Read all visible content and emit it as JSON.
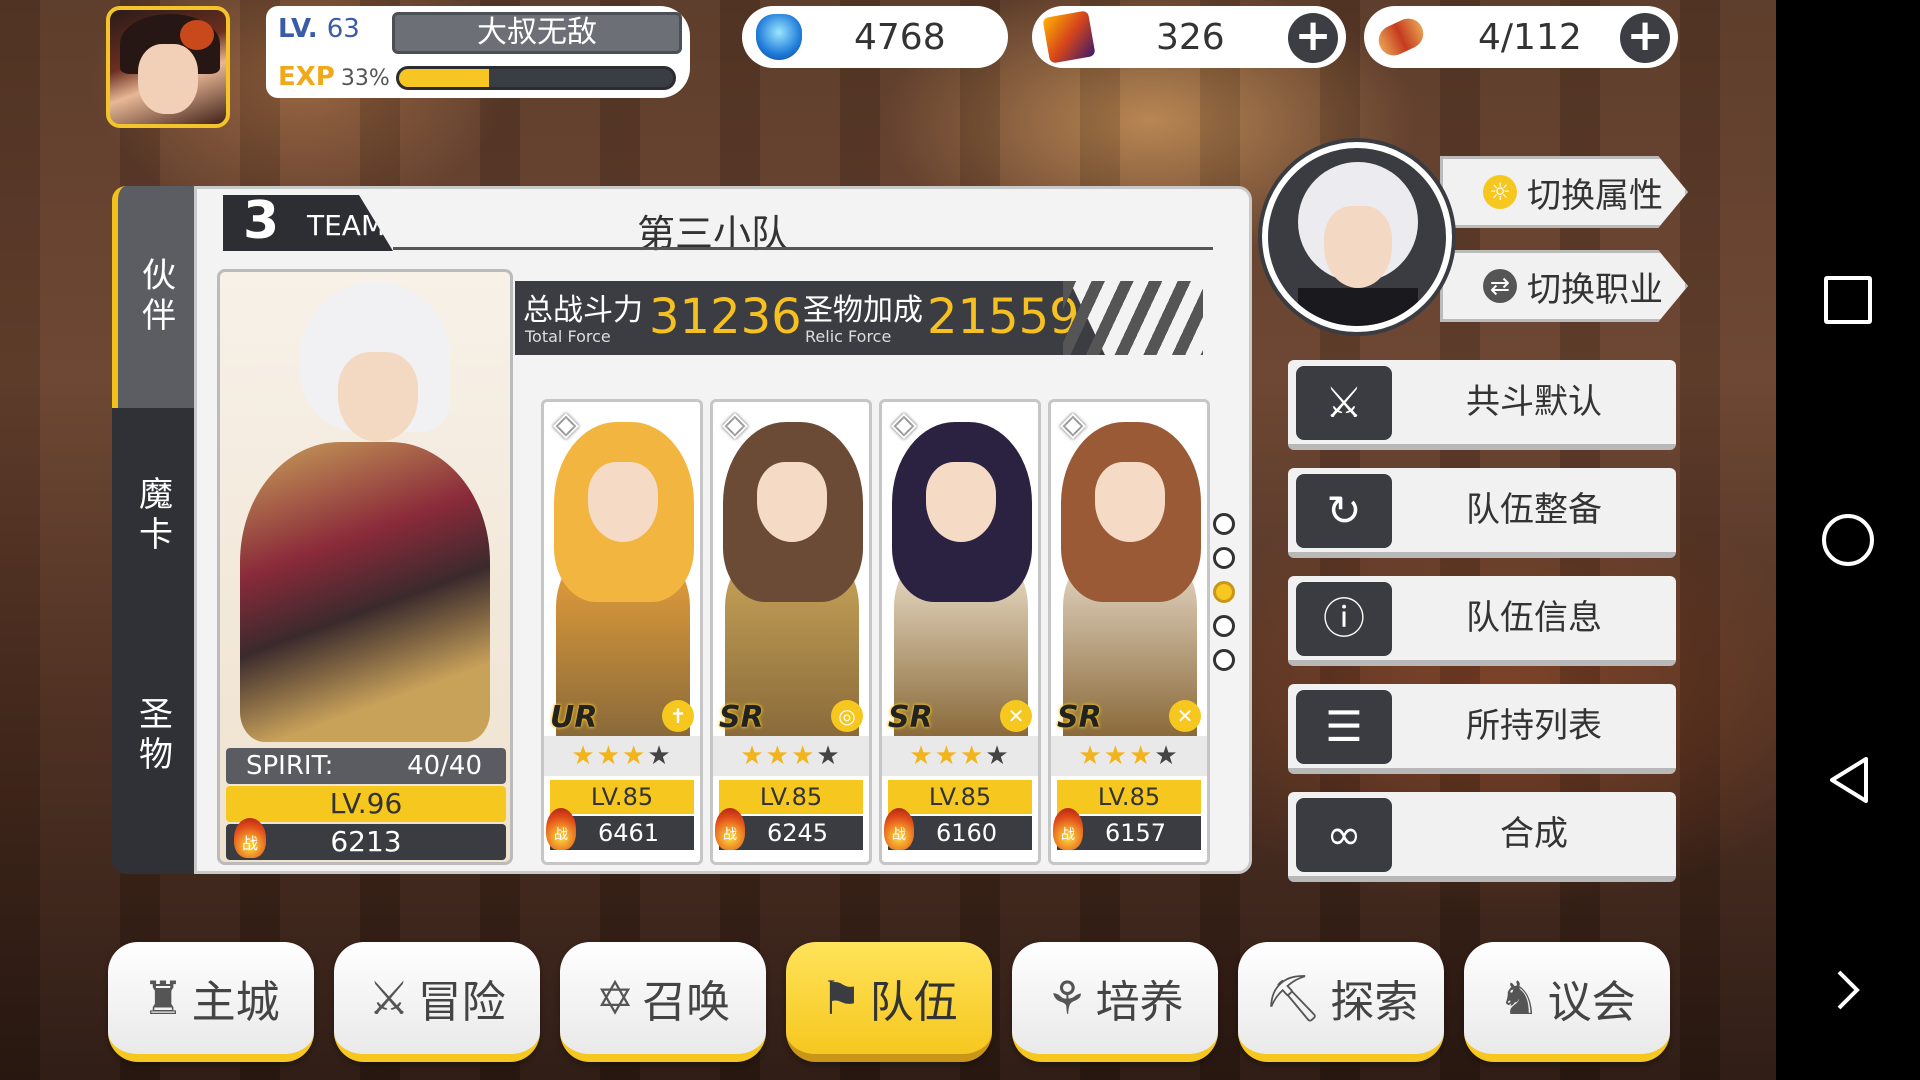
{
  "player": {
    "level_label": "LV.",
    "level": "63",
    "name": "大叔无敌",
    "exp_label": "EXP",
    "exp_percent": "33%",
    "exp_fraction": 0.33
  },
  "resources": [
    {
      "icon": "crystal-icon",
      "value": "4768",
      "has_plus": false
    },
    {
      "icon": "chest-icon",
      "value": "326",
      "has_plus": true
    },
    {
      "icon": "food-icon",
      "value": "4/112",
      "has_plus": true
    }
  ],
  "side_tabs": [
    "伙伴",
    "魔卡",
    "圣物"
  ],
  "team": {
    "number": "3",
    "word": "TEAM",
    "name": "第三小队",
    "total_force_label": "总战斗力",
    "total_force_sub": "Total Force",
    "total_force": "31236",
    "relic_force_label": "圣物加成",
    "relic_force_sub": "Relic Force",
    "relic_force": "21559"
  },
  "leader": {
    "spirit_label": "SPIRIT:",
    "spirit_value": "40/40",
    "level": "LV.96",
    "power_tag": "战",
    "power": "6213"
  },
  "members": [
    {
      "rarity": "UR",
      "stars": 3,
      "max_stars": 4,
      "level": "LV.85",
      "power_tag": "战",
      "power": "6461",
      "hair": "#f2b540",
      "body": "#e8a03a"
    },
    {
      "rarity": "SR",
      "stars": 3,
      "max_stars": 4,
      "level": "LV.85",
      "power_tag": "战",
      "power": "6245",
      "hair": "#6b4a36",
      "body": "#c9a65a"
    },
    {
      "rarity": "SR",
      "stars": 3,
      "max_stars": 4,
      "level": "LV.85",
      "power_tag": "战",
      "power": "6160",
      "hair": "#2a2240",
      "body": "#efe4cf"
    },
    {
      "rarity": "SR",
      "stars": 3,
      "max_stars": 4,
      "level": "LV.85",
      "power_tag": "战",
      "power": "6157",
      "hair": "#9a5a36",
      "body": "#e8dccb"
    }
  ],
  "page_dots": {
    "count": 5,
    "active_index": 2
  },
  "switches": {
    "attr": "切换属性",
    "job": "切换职业"
  },
  "menu": [
    "共斗默认",
    "队伍整备",
    "队伍信息",
    "所持列表",
    "合成"
  ],
  "bottom_nav": [
    {
      "label": "主城",
      "icon": "castle-icon",
      "active": false
    },
    {
      "label": "冒险",
      "icon": "swords-icon",
      "active": false
    },
    {
      "label": "召唤",
      "icon": "hexagram-icon",
      "active": false
    },
    {
      "label": "队伍",
      "icon": "team-icon",
      "active": true
    },
    {
      "label": "培养",
      "icon": "nurture-icon",
      "active": false
    },
    {
      "label": "探索",
      "icon": "explore-icon",
      "active": false
    },
    {
      "label": "议会",
      "icon": "council-icon",
      "active": false
    }
  ]
}
